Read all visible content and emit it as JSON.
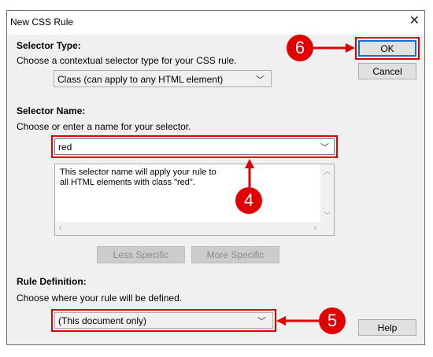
{
  "window": {
    "title": "New CSS Rule",
    "close_glyph": "✕"
  },
  "selector_type": {
    "heading": "Selector Type:",
    "instruction": "Choose a contextual selector type for your CSS rule.",
    "selected": "Class (can apply to any HTML element)"
  },
  "selector_name": {
    "heading": "Selector Name:",
    "instruction": "Choose or enter a name for your selector.",
    "value": "red",
    "description": "This selector name will apply your rule to\nall HTML elements with class \"red\"."
  },
  "buttons": {
    "ok": "OK",
    "cancel": "Cancel",
    "less_specific": "Less Specific",
    "more_specific": "More Specific",
    "help": "Help"
  },
  "rule_definition": {
    "heading": "Rule Definition:",
    "instruction": "Choose where your rule will be defined.",
    "selected": "(This document only)"
  },
  "annotations": {
    "step4": "4",
    "step5": "5",
    "step6": "6"
  },
  "colors": {
    "annotation_red": "#e00000",
    "default_button_border": "#0078d7"
  }
}
